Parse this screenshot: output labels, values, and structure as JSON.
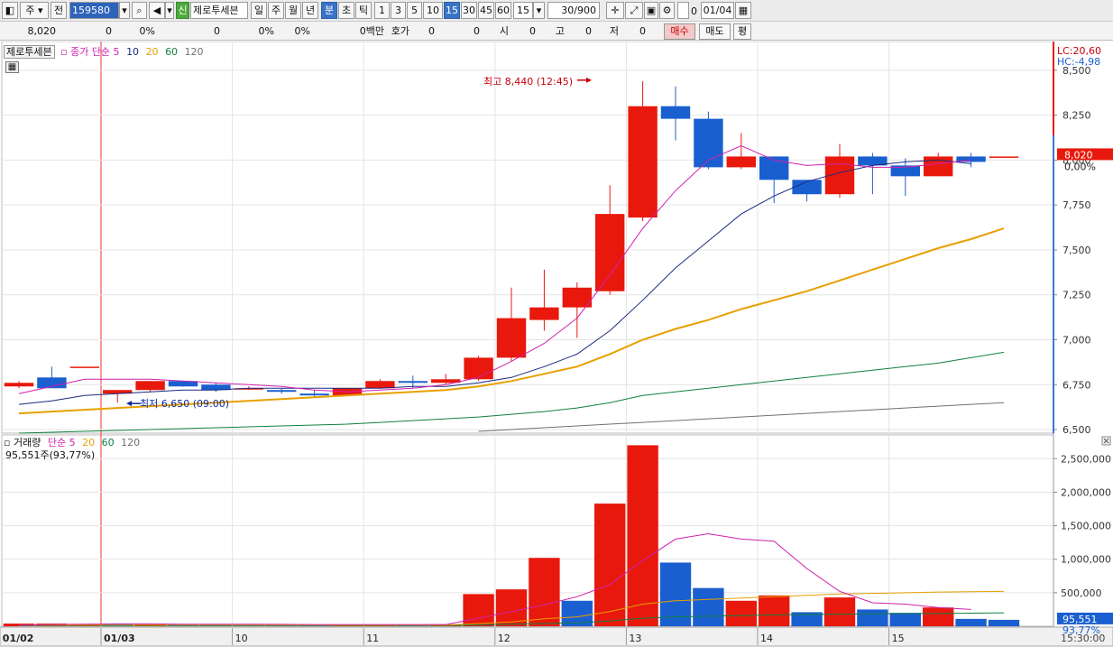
{
  "toolbar": {
    "mode": "주",
    "prev": "전",
    "code": "159580",
    "new_badge": "신",
    "name": "제로투세븐",
    "periods": [
      "일",
      "주",
      "월",
      "년",
      "분",
      "초",
      "틱"
    ],
    "period_selected": "분",
    "minutes": [
      "1",
      "3",
      "5",
      "10",
      "15",
      "30",
      "45",
      "60"
    ],
    "minute_selected": "15",
    "minute_select": "15",
    "count": "30/900",
    "check_label": "0",
    "date": "01/04"
  },
  "quote": {
    "price": "8,020",
    "change": "0",
    "change_pct": "0%",
    "v1": "0",
    "v1_pct": "0%",
    "v2_pct": "0%",
    "trade_value": "0백만",
    "hoga_label": "호가",
    "hoga": "0",
    "hoga2": "0",
    "open_label": "시",
    "open": "0",
    "high_label": "고",
    "high": "0",
    "low_label": "저",
    "low": "0",
    "buy": "매수",
    "sell": "매도",
    "avg": "평"
  },
  "chart_data": [
    {
      "type": "candlestick",
      "name": "price",
      "legend_tag": "제로투세븐",
      "legend": [
        {
          "name": "종가 단순 5",
          "color": "#d020b0"
        },
        {
          "name": "10",
          "color": "#1a2a80"
        },
        {
          "name": "20",
          "color": "#e8a000"
        },
        {
          "name": "60",
          "color": "#108040"
        },
        {
          "name": "120",
          "color": "#707070"
        }
      ],
      "ylim": [
        6480,
        8640
      ],
      "yticks": [
        6500,
        6750,
        7000,
        7250,
        7500,
        7750,
        8000,
        8250,
        8500
      ],
      "ytick_labels": [
        "6,500",
        "6,750",
        "7,000",
        "7,250",
        "7,500",
        "7,750",
        "8,000",
        "8,250",
        "8,500"
      ],
      "candles": [
        [
          6740,
          6760,
          6730,
          6770
        ],
        [
          6790,
          6730,
          6730,
          6850
        ],
        [
          6850,
          6850,
          6850,
          6850
        ],
        [
          6700,
          6720,
          6650,
          6720
        ],
        [
          6720,
          6770,
          6710,
          6770
        ],
        [
          6770,
          6740,
          6740,
          6770
        ],
        [
          6750,
          6720,
          6710,
          6760
        ],
        [
          6730,
          6730,
          6720,
          6740
        ],
        [
          6720,
          6710,
          6700,
          6730
        ],
        [
          6700,
          6690,
          6680,
          6720
        ],
        [
          6690,
          6730,
          6690,
          6730
        ],
        [
          6730,
          6770,
          6730,
          6780
        ],
        [
          6770,
          6760,
          6730,
          6800
        ],
        [
          6760,
          6780,
          6750,
          6810
        ],
        [
          6780,
          6900,
          6770,
          6910
        ],
        [
          6900,
          7120,
          6880,
          7290
        ],
        [
          7110,
          7180,
          7050,
          7390
        ],
        [
          7180,
          7290,
          7010,
          7320
        ],
        [
          7270,
          7700,
          7250,
          7860
        ],
        [
          7680,
          8300,
          7660,
          8440
        ],
        [
          8300,
          8230,
          8110,
          8410
        ],
        [
          8230,
          7960,
          7950,
          8270
        ],
        [
          7960,
          8020,
          7950,
          8150
        ],
        [
          8020,
          7890,
          7760,
          8020
        ],
        [
          7890,
          7810,
          7770,
          7890
        ],
        [
          7810,
          8020,
          7790,
          8090
        ],
        [
          8020,
          7970,
          7810,
          8040
        ],
        [
          7970,
          7910,
          7800,
          8010
        ],
        [
          7910,
          8020,
          7910,
          8040
        ],
        [
          8020,
          7990,
          7960,
          8040
        ],
        [
          8020,
          8020,
          8020,
          8020
        ]
      ],
      "ma5": [
        6700,
        6740,
        6780,
        6780,
        6780,
        6770,
        6760,
        6750,
        6740,
        6720,
        6710,
        6720,
        6730,
        6750,
        6790,
        6880,
        6980,
        7120,
        7360,
        7620,
        7830,
        8000,
        8080,
        8000,
        7970,
        7980,
        7960,
        7960,
        7980,
        8000
      ],
      "ma10": [
        6640,
        6660,
        6690,
        6700,
        6710,
        6720,
        6720,
        6730,
        6730,
        6730,
        6730,
        6730,
        6740,
        6740,
        6760,
        6790,
        6850,
        6920,
        7050,
        7220,
        7400,
        7550,
        7700,
        7800,
        7880,
        7930,
        7970,
        7990,
        8000,
        7980
      ],
      "ma20": [
        6590,
        6600,
        6610,
        6620,
        6630,
        6640,
        6650,
        6660,
        6670,
        6680,
        6690,
        6700,
        6710,
        6720,
        6740,
        6770,
        6810,
        6850,
        6920,
        7000,
        7060,
        7110,
        7170,
        7220,
        7270,
        7330,
        7390,
        7450,
        7510,
        7560,
        7620
      ],
      "ma60": [
        6480,
        6485,
        6490,
        6495,
        6500,
        6505,
        6510,
        6515,
        6520,
        6525,
        6530,
        6540,
        6550,
        6560,
        6570,
        6585,
        6600,
        6620,
        6650,
        6690,
        6710,
        6730,
        6750,
        6770,
        6790,
        6810,
        6830,
        6850,
        6870,
        6900,
        6930
      ],
      "ma120": [
        null,
        null,
        null,
        null,
        null,
        null,
        null,
        null,
        null,
        null,
        null,
        null,
        null,
        null,
        6490,
        6500,
        6510,
        6520,
        6530,
        6540,
        6550,
        6560,
        6570,
        6580,
        6590,
        6600,
        6610,
        6620,
        6630,
        6640,
        6650
      ],
      "annotations": {
        "high": "최고 8,440 (12:45)",
        "low": "최저 6,650 (09:00)",
        "lc": "LC:20,60",
        "hc": "HC:-4,98",
        "last_price": "8,020",
        "last_change": "0,00%"
      }
    },
    {
      "type": "bar",
      "name": "volume",
      "legend": [
        {
          "name": "거래량",
          "color": "#222"
        },
        {
          "name": "단순 5",
          "color": "#d020b0"
        },
        {
          "name": "20",
          "color": "#e8a000"
        },
        {
          "name": "60",
          "color": "#108040"
        },
        {
          "name": "120",
          "color": "#707070"
        }
      ],
      "info": "95,551주(93,77%)",
      "ylim": [
        0,
        2800000
      ],
      "yticks": [
        500000,
        1000000,
        1500000,
        2000000,
        2500000
      ],
      "ytick_labels": [
        "500,000",
        "1,000,000",
        "1,500,000",
        "2,000,000",
        "2,500,000"
      ],
      "values": [
        40000,
        40000,
        35000,
        35000,
        30000,
        30000,
        30000,
        25000,
        25000,
        25000,
        25000,
        25000,
        25000,
        30000,
        480000,
        550000,
        1020000,
        380000,
        1830000,
        2700000,
        950000,
        570000,
        380000,
        460000,
        210000,
        430000,
        250000,
        200000,
        280000,
        110000,
        95551
      ],
      "up": [
        1,
        1,
        1,
        0,
        1,
        0,
        0,
        0,
        0,
        0,
        1,
        1,
        0,
        1,
        1,
        1,
        1,
        0,
        1,
        1,
        0,
        0,
        1,
        1,
        0,
        1,
        0,
        0,
        1,
        0,
        0
      ],
      "ma5": [
        20000,
        25000,
        30000,
        35000,
        35000,
        30000,
        30000,
        30000,
        28000,
        26000,
        25000,
        25000,
        25000,
        25000,
        120000,
        220000,
        320000,
        440000,
        620000,
        980000,
        1300000,
        1380000,
        1300000,
        1270000,
        860000,
        520000,
        350000,
        330000,
        280000,
        250000
      ],
      "ma20": [
        18000,
        18000,
        18000,
        18000,
        18000,
        18000,
        18000,
        18000,
        18000,
        18000,
        18000,
        18000,
        18000,
        18000,
        40000,
        65000,
        110000,
        140000,
        220000,
        330000,
        380000,
        400000,
        420000,
        440000,
        460000,
        480000,
        490000,
        500000,
        510000,
        515000,
        520000
      ],
      "ma60": [
        10000,
        10000,
        10000,
        10000,
        10000,
        10000,
        10000,
        10000,
        10000,
        10000,
        10000,
        10000,
        10000,
        10000,
        20000,
        30000,
        40000,
        50000,
        80000,
        120000,
        140000,
        150000,
        160000,
        170000,
        175000,
        180000,
        185000,
        190000,
        190000,
        195000,
        200000
      ],
      "annotations": {
        "last_volume": "95,551",
        "last_ratio": "93,77%"
      }
    }
  ],
  "xaxis": {
    "labels": [
      "01/02",
      "01/03",
      "10",
      "11",
      "12",
      "13",
      "14",
      "15"
    ],
    "time": "15:30:00"
  }
}
